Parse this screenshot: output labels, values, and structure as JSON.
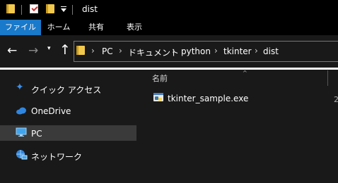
{
  "window": {
    "title": "dist"
  },
  "ribbon": {
    "tabs": [
      "ファイル",
      "ホーム",
      "共有",
      "表示"
    ],
    "active_tab_color": "#1979ca"
  },
  "address": {
    "crumbs": [
      "PC",
      "ドキュメント",
      "python",
      "tkinter",
      "dist"
    ],
    "separator": "›"
  },
  "nav_pane": {
    "items": [
      {
        "label": "クイック アクセス",
        "icon": "star-icon"
      },
      {
        "label": "OneDrive",
        "icon": "cloud-icon"
      },
      {
        "label": "PC",
        "icon": "monitor-icon",
        "selected": true
      },
      {
        "label": "ネットワーク",
        "icon": "network-icon"
      }
    ]
  },
  "content": {
    "column_header": "名前",
    "files": [
      {
        "name": "tkinter_sample.exe",
        "icon": "python-exe-icon"
      }
    ],
    "edge_char": "2"
  }
}
